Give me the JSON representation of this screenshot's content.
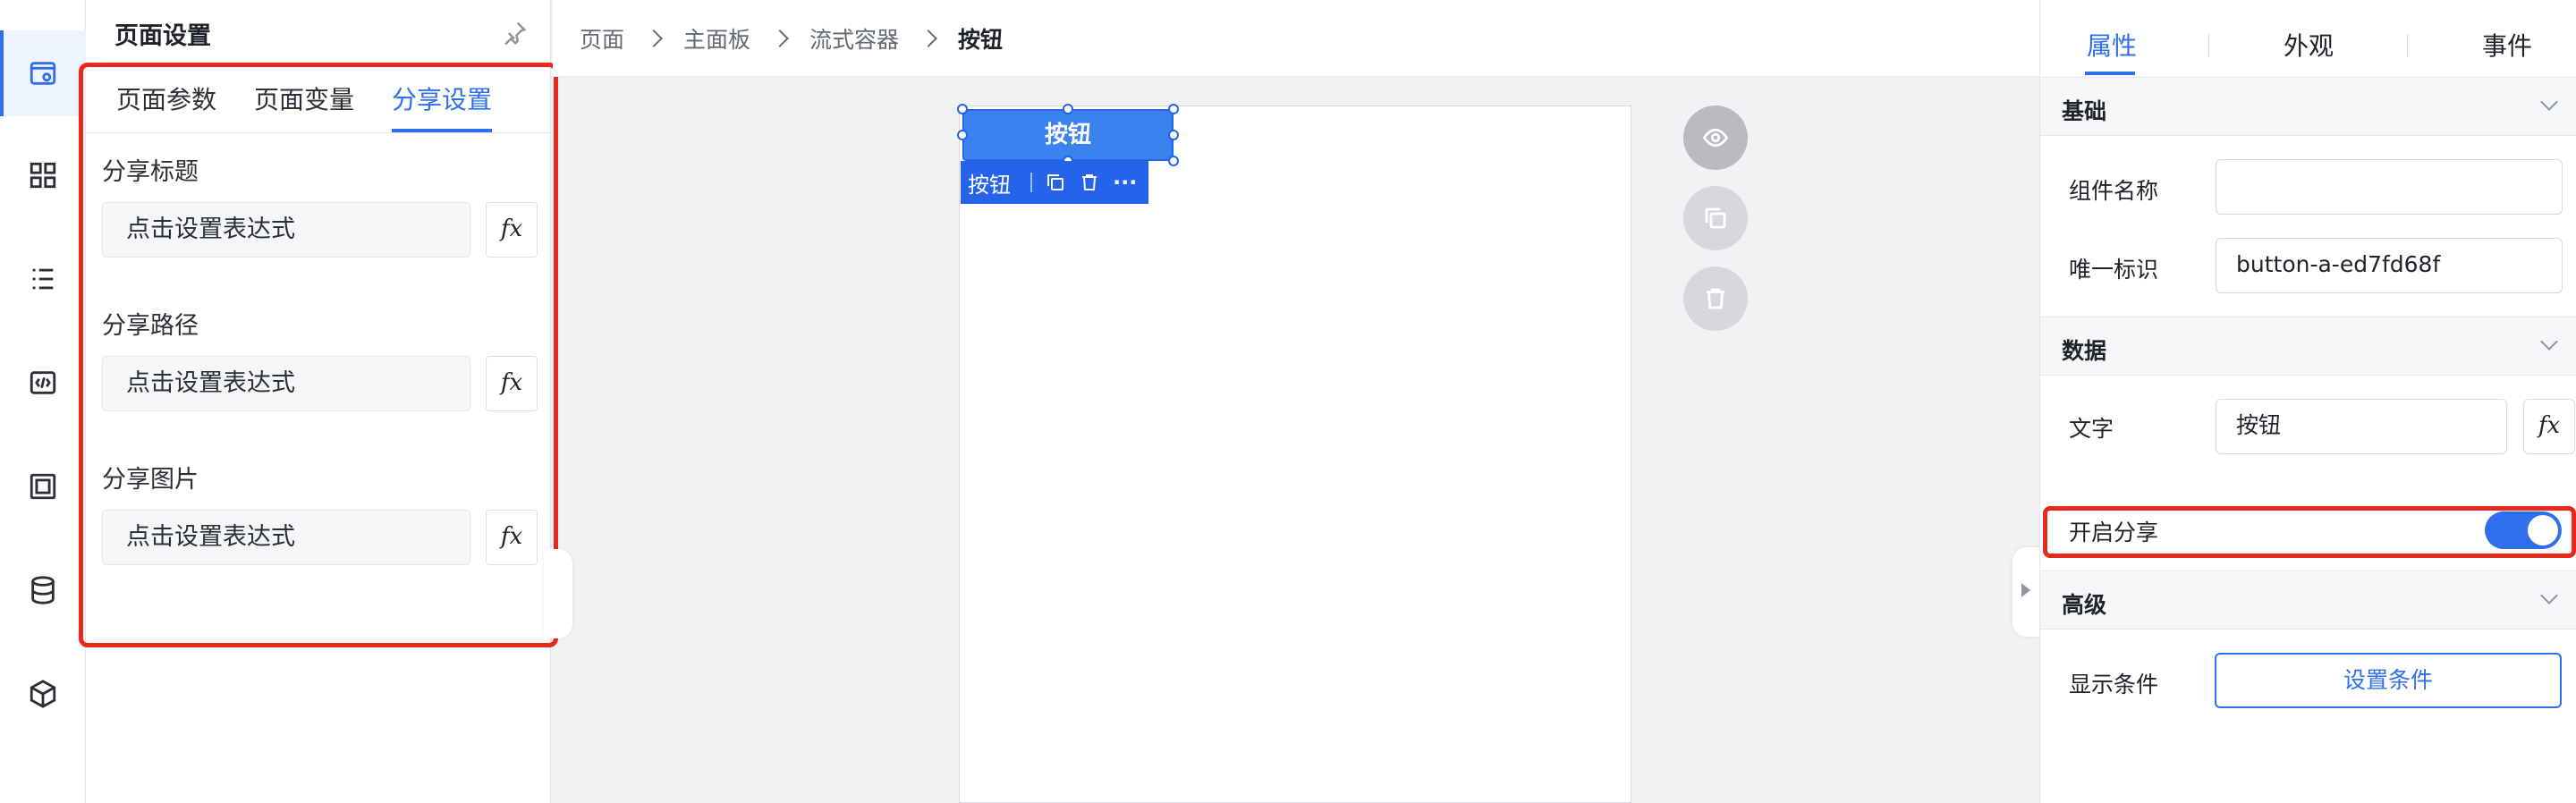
{
  "rail": {
    "items": [
      {
        "icon": "page-settings-icon"
      },
      {
        "icon": "components-grid-icon"
      },
      {
        "icon": "outline-tree-icon"
      },
      {
        "icon": "code-icon"
      },
      {
        "icon": "template-icon"
      },
      {
        "icon": "database-icon"
      },
      {
        "icon": "package-icon"
      }
    ]
  },
  "panel": {
    "title": "页面设置",
    "tabs": [
      {
        "label": "页面参数"
      },
      {
        "label": "页面变量"
      },
      {
        "label": "分享设置"
      }
    ],
    "active_tab": "分享设置",
    "fields": [
      {
        "label": "分享标题",
        "placeholder": "点击设置表达式",
        "fx": "fx"
      },
      {
        "label": "分享路径",
        "placeholder": "点击设置表达式",
        "fx": "fx"
      },
      {
        "label": "分享图片",
        "placeholder": "点击设置表达式",
        "fx": "fx"
      }
    ]
  },
  "breadcrumb": [
    "页面",
    "主面板",
    "流式容器",
    "按钮"
  ],
  "canvas": {
    "button_text": "按钮",
    "toolbar_label": "按钮",
    "toolbar_more": "···"
  },
  "props": {
    "tabs": [
      {
        "label": "属性"
      },
      {
        "label": "外观"
      },
      {
        "label": "事件"
      }
    ],
    "sections": {
      "basic": "基础",
      "data": "数据",
      "advanced": "高级"
    },
    "component_name_label": "组件名称",
    "component_name_value": "",
    "unique_id_label": "唯一标识",
    "unique_id_value": "button-a-ed7fd68f",
    "text_label": "文字",
    "text_value": "按钮",
    "text_fx": "fx",
    "share_label": "开启分享",
    "share_enabled": true,
    "display_cond_label": "显示条件",
    "display_cond_button": "设置条件"
  },
  "colors": {
    "accent": "#2f6feb",
    "highlight": "#e8281b"
  }
}
